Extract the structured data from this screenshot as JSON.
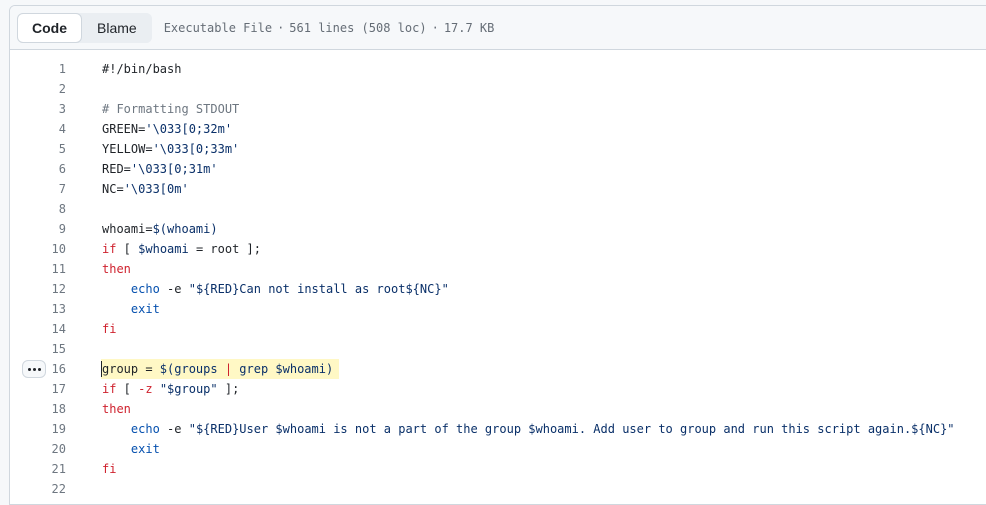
{
  "header": {
    "tabs": [
      {
        "label": "Code",
        "active": true
      },
      {
        "label": "Blame",
        "active": false
      }
    ],
    "file_type": "Executable File",
    "line_count": "561 lines (508 loc)",
    "file_size": "17.7 KB",
    "separator": "·"
  },
  "code": {
    "lines": [
      {
        "n": "1",
        "html": "#!/bin/bash"
      },
      {
        "n": "2",
        "html": ""
      },
      {
        "n": "3",
        "html": "<span class='cmt'># Formatting STDOUT</span>"
      },
      {
        "n": "4",
        "html": "GREEN=<span class='str'>'\\033[0;32m'</span>"
      },
      {
        "n": "5",
        "html": "YELLOW=<span class='str'>'\\033[0;33m'</span>"
      },
      {
        "n": "6",
        "html": "RED=<span class='str'>'\\033[0;31m'</span>"
      },
      {
        "n": "7",
        "html": "NC=<span class='str'>'\\033[0m'</span>"
      },
      {
        "n": "8",
        "html": ""
      },
      {
        "n": "9",
        "html": "whoami=<span class='str'>$(whoami)</span>"
      },
      {
        "n": "10",
        "html": "<span class='kw'>if</span> [ <span class='str'>$whoami</span> = root ];"
      },
      {
        "n": "11",
        "html": "<span class='kw'>then</span>"
      },
      {
        "n": "12",
        "html": "    <span class='cmd'>echo</span> -e <span class='str'>\"${RED}Can not install as root${NC}\"</span>"
      },
      {
        "n": "13",
        "html": "    <span class='cmd'>exit</span>"
      },
      {
        "n": "14",
        "html": "<span class='kw'>fi</span>"
      },
      {
        "n": "15",
        "html": ""
      },
      {
        "n": "16",
        "html": "group = <span class='str'>$(groups <span class='kw'>|</span> grep $whoami)</span>",
        "highlight": true
      },
      {
        "n": "17",
        "html": "<span class='kw'>if</span> [ <span class='kw'>-z</span> <span class='str'>\"$group\"</span> ];"
      },
      {
        "n": "18",
        "html": "<span class='kw'>then</span>"
      },
      {
        "n": "19",
        "html": "    <span class='cmd'>echo</span> -e <span class='str'>\"${RED}User $whoami is not a part of the group $whoami. Add user to group and run this script again.${NC}\"</span>"
      },
      {
        "n": "20",
        "html": "    <span class='cmd'>exit</span>"
      },
      {
        "n": "21",
        "html": "<span class='kw'>fi</span>"
      },
      {
        "n": "22",
        "html": ""
      }
    ]
  }
}
